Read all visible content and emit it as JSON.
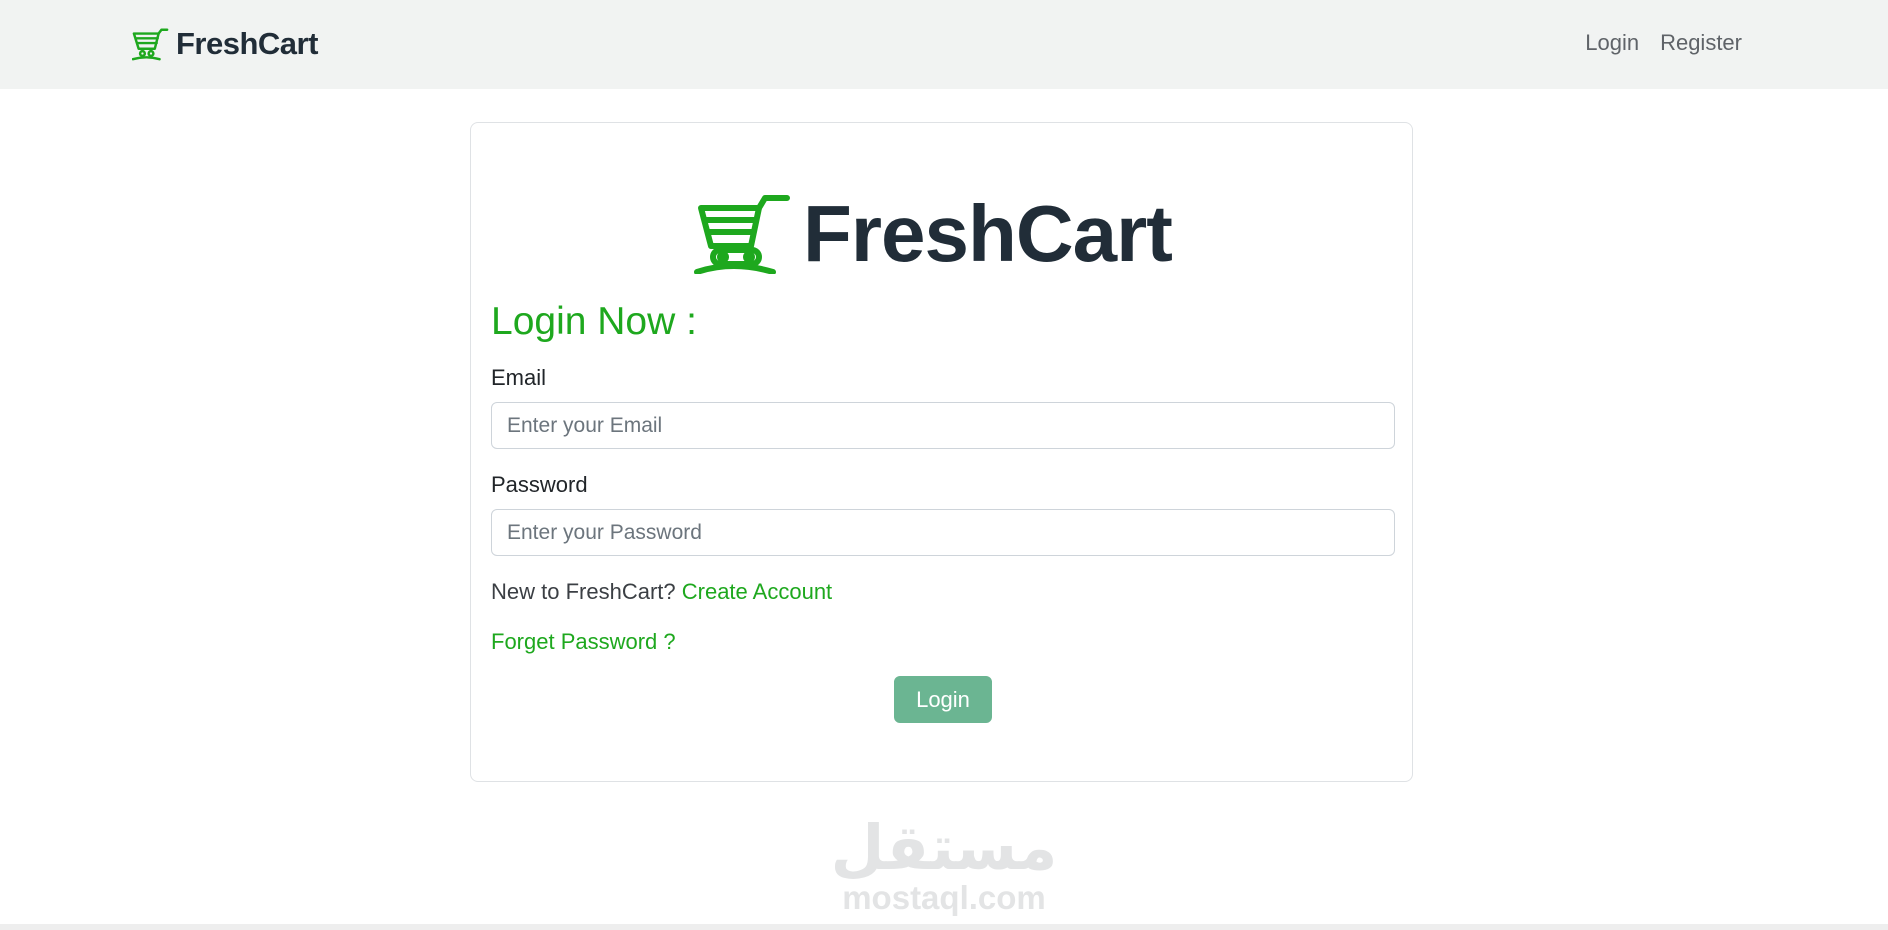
{
  "navbar": {
    "brand": "FreshCart",
    "links": [
      {
        "label": "Login"
      },
      {
        "label": "Register"
      }
    ]
  },
  "card": {
    "logo_text": "FreshCart",
    "title": "Login Now :",
    "email": {
      "label": "Email",
      "placeholder": "Enter your Email",
      "value": ""
    },
    "password": {
      "label": "Password",
      "placeholder": "Enter your Password",
      "value": ""
    },
    "new_prompt": "New to FreshCart?",
    "create_account": "Create Account",
    "forget_password": "Forget Password ?",
    "login_button": "Login"
  },
  "watermark": {
    "arabic": "مستقل",
    "latin": "mostaql.com"
  },
  "icons": {
    "brand": "shopping-cart-icon",
    "logo": "shopping-cart-icon"
  },
  "colors": {
    "accent_green": "#1ea81e",
    "dark_text": "#212d38",
    "button_green": "#6bb592",
    "navbar_bg": "#f1f3f2"
  }
}
